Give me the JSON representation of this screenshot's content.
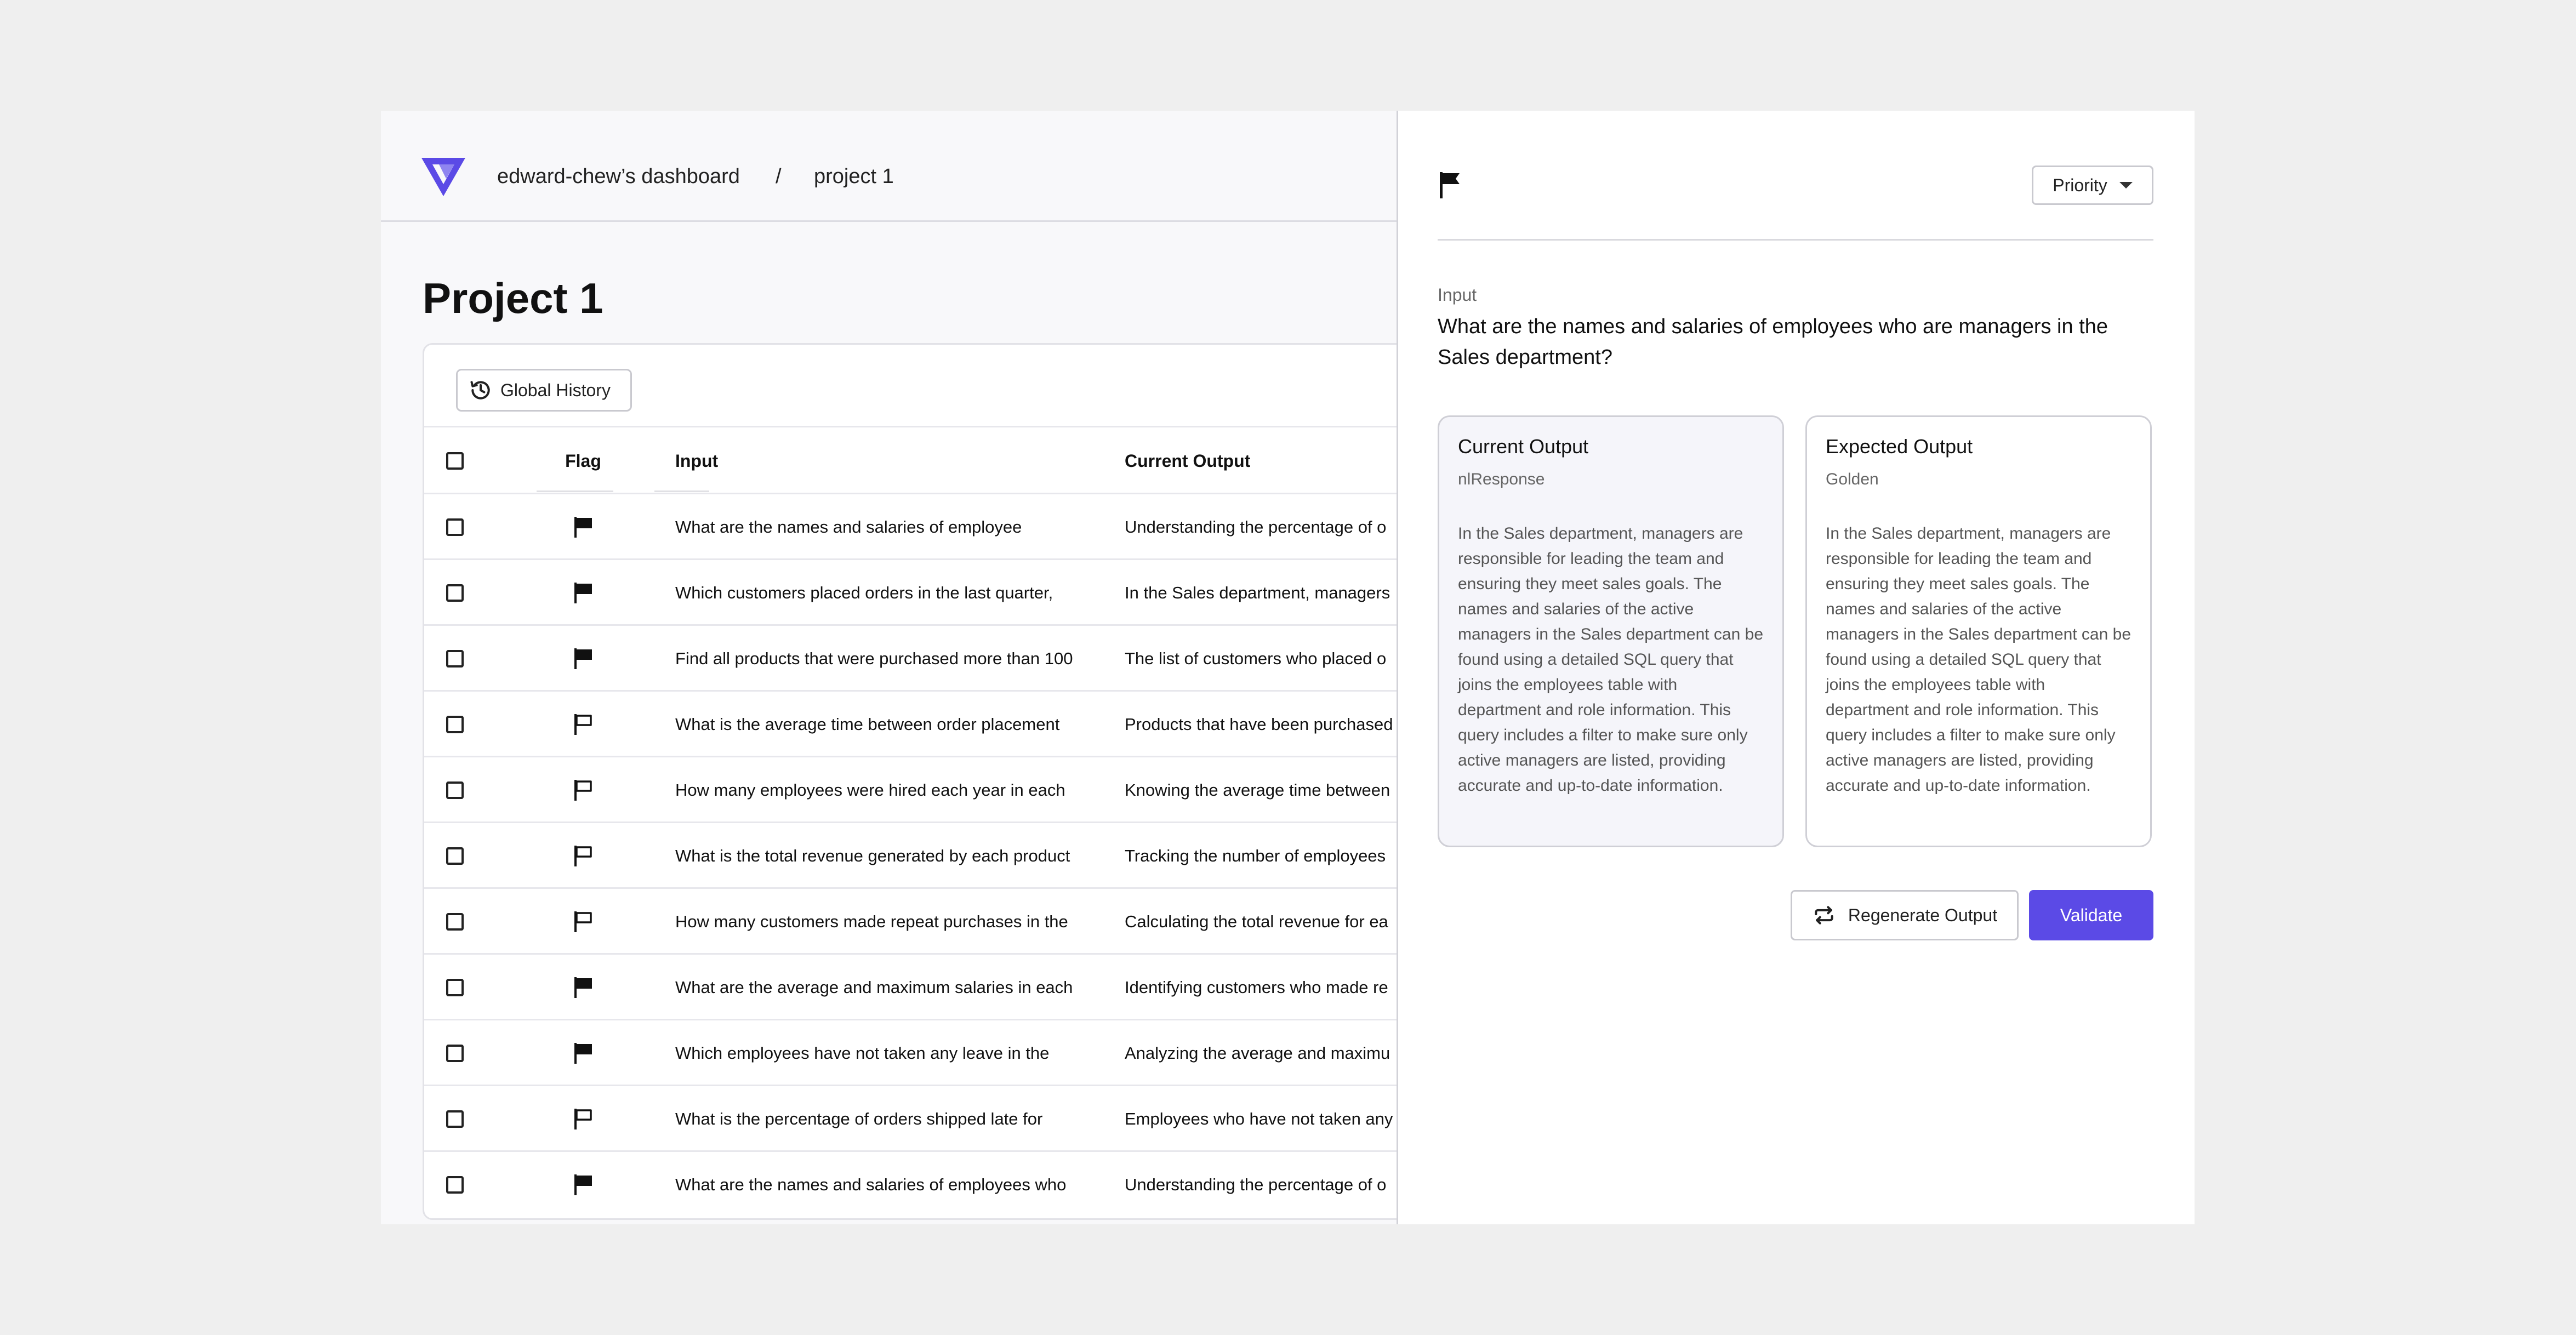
{
  "header": {
    "dashboard_crumb": "edward-chew’s dashboard",
    "separator": "/",
    "project_crumb": "project 1",
    "brand_color": "#5b4ae6"
  },
  "page": {
    "title": "Project 1"
  },
  "table": {
    "history_button": "Global History",
    "history_icon": "history-icon",
    "columns": {
      "flag": "Flag",
      "input": "Input",
      "current_output": "Current Output"
    },
    "rows": [
      {
        "flagged": true,
        "input": "What are the names and salaries of employee",
        "output": "Understanding the percentage of o"
      },
      {
        "flagged": true,
        "input": "Which customers placed orders in the last quarter,",
        "output": "In the Sales department, managers"
      },
      {
        "flagged": true,
        "input": "Find all products that were purchased more than 100",
        "output": "The list of customers who placed o"
      },
      {
        "flagged": false,
        "input": "What is the average time between order placement",
        "output": "Products that have been purchased"
      },
      {
        "flagged": false,
        "input": "How many employees were hired each year in each",
        "output": "Knowing the average time between"
      },
      {
        "flagged": false,
        "input": "What is the total revenue generated by each product",
        "output": "Tracking the number of employees"
      },
      {
        "flagged": false,
        "input": "How many customers made repeat purchases in the",
        "output": "Calculating the total revenue for ea"
      },
      {
        "flagged": true,
        "input": "What are the average and maximum salaries in each",
        "output": "Identifying customers who made re"
      },
      {
        "flagged": true,
        "input": "Which employees have not taken any leave in the",
        "output": "Analyzing the average and maximu"
      },
      {
        "flagged": false,
        "input": "What is the percentage of orders shipped late for",
        "output": "Employees who have not taken any"
      },
      {
        "flagged": true,
        "input": "What are the names and salaries of employees who",
        "output": "Understanding the percentage of o"
      }
    ]
  },
  "panel": {
    "flag_icon": "flag-filled-icon",
    "priority_label": "Priority",
    "input_label": "Input",
    "input_text": "What are the names and salaries of employees who are managers in the Sales department?",
    "current_output": {
      "title": "Current Output",
      "subtitle": "nlResponse",
      "body": "In the Sales department, managers are responsible for leading the team and ensuring they meet sales goals. The names and salaries of the active managers in the Sales department can be found using a detailed SQL query that joins the employees table with department and role information. This query includes a filter to make sure only active managers are listed, providing accurate and up-to-date information."
    },
    "expected_output": {
      "title": "Expected Output",
      "subtitle": "Golden",
      "body": "In the Sales department, managers are responsible for leading the team and ensuring they meet sales goals. The names and salaries of the active managers in the Sales department can be found using a detailed SQL query that joins the employees table with department and role information. This query includes a filter to make sure only active managers are listed, providing accurate and up-to-date information."
    },
    "regenerate_label": "Regenerate Output",
    "validate_label": "Validate"
  }
}
